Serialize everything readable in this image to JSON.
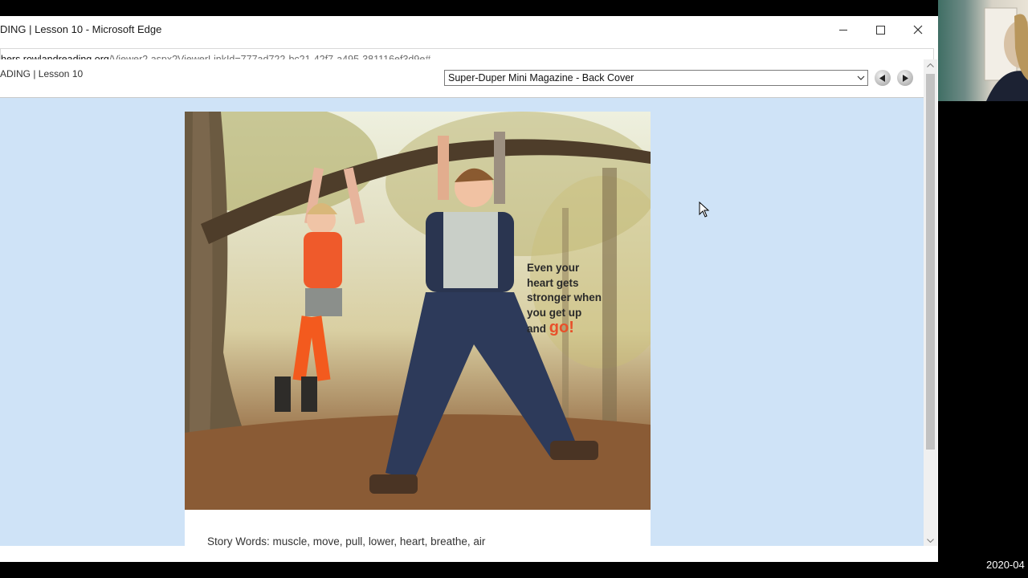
{
  "window": {
    "title": "DING | Lesson 10 - Microsoft Edge"
  },
  "address": {
    "host": "hers.rowlandreading.org",
    "path": "/Viewer2.aspx?ViewerLinkId=777ad722-bc21-42f7-a495-381116ef3d9e#"
  },
  "viewer": {
    "breadcrumb": "ADING | Lesson 10",
    "page_select": "Super-Duper Mini Magazine - Back Cover"
  },
  "page": {
    "caption_line1": "Even your",
    "caption_line2": "heart gets",
    "caption_line3": "stronger when",
    "caption_line4": "you get up",
    "caption_line5": "and",
    "caption_emph": "go!",
    "story_words": "Story Words: muscle, move, pull, lower, heart, breathe, air"
  },
  "overlay": {
    "timestamp": "2020-04"
  },
  "colors": {
    "viewer_bg": "#cfe3f7",
    "emphasis": "#e8502a"
  },
  "icons": {
    "minimize": "minimize-icon",
    "maximize": "maximize-icon",
    "close": "close-icon",
    "prev": "previous-page-icon",
    "next": "next-page-icon",
    "dropdown": "chevron-down-icon",
    "cursor": "mouse-pointer-icon"
  }
}
